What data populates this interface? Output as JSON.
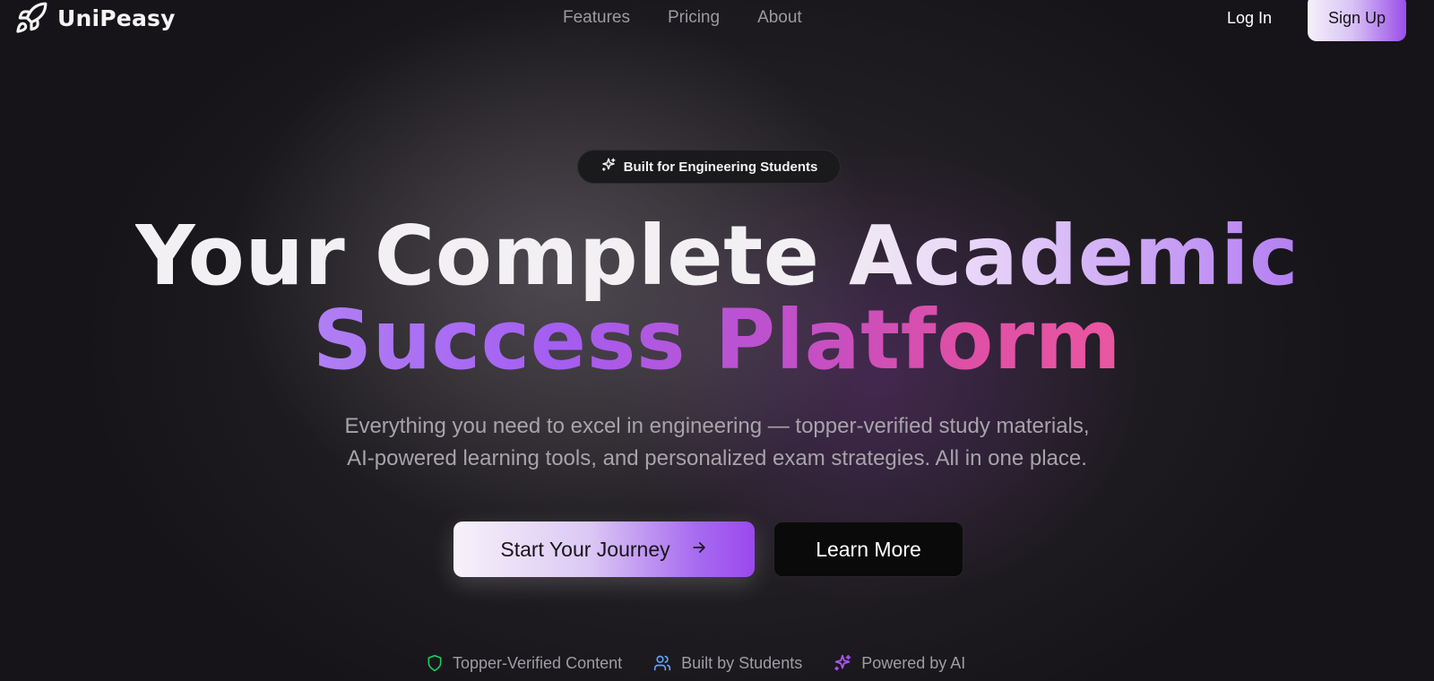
{
  "nav": {
    "brand": "UniPeasy",
    "brand_icon": "rocket-icon",
    "links": [
      {
        "label": "Features"
      },
      {
        "label": "Pricing"
      },
      {
        "label": "About"
      }
    ],
    "login_label": "Log In",
    "signup_label": "Sign Up"
  },
  "hero": {
    "badge": {
      "icon": "sparkles-icon",
      "label": "Built for Engineering Students"
    },
    "headline_line1": "Your Complete Academic",
    "headline_line2": "Success Platform",
    "subtitle_line1": "Everything you need to excel in engineering — topper-verified study materials,",
    "subtitle_line2": "AI-powered learning tools, and personalized exam strategies. All in one place.",
    "primary_cta": {
      "label": "Start Your Journey",
      "icon": "arrow-right-icon"
    },
    "secondary_cta": {
      "label": "Learn More"
    }
  },
  "features": [
    {
      "icon": "shield-icon",
      "label": "Topper-Verified Content",
      "color": "#22c55e"
    },
    {
      "icon": "users-icon",
      "label": "Built by Students",
      "color": "#60a5fa"
    },
    {
      "icon": "sparkles-icon",
      "label": "Powered by AI",
      "color": "#a855f7"
    }
  ],
  "colors": {
    "accent_purple": "#9b48ee",
    "accent_pink": "#ea57a0",
    "background": "#161418"
  }
}
